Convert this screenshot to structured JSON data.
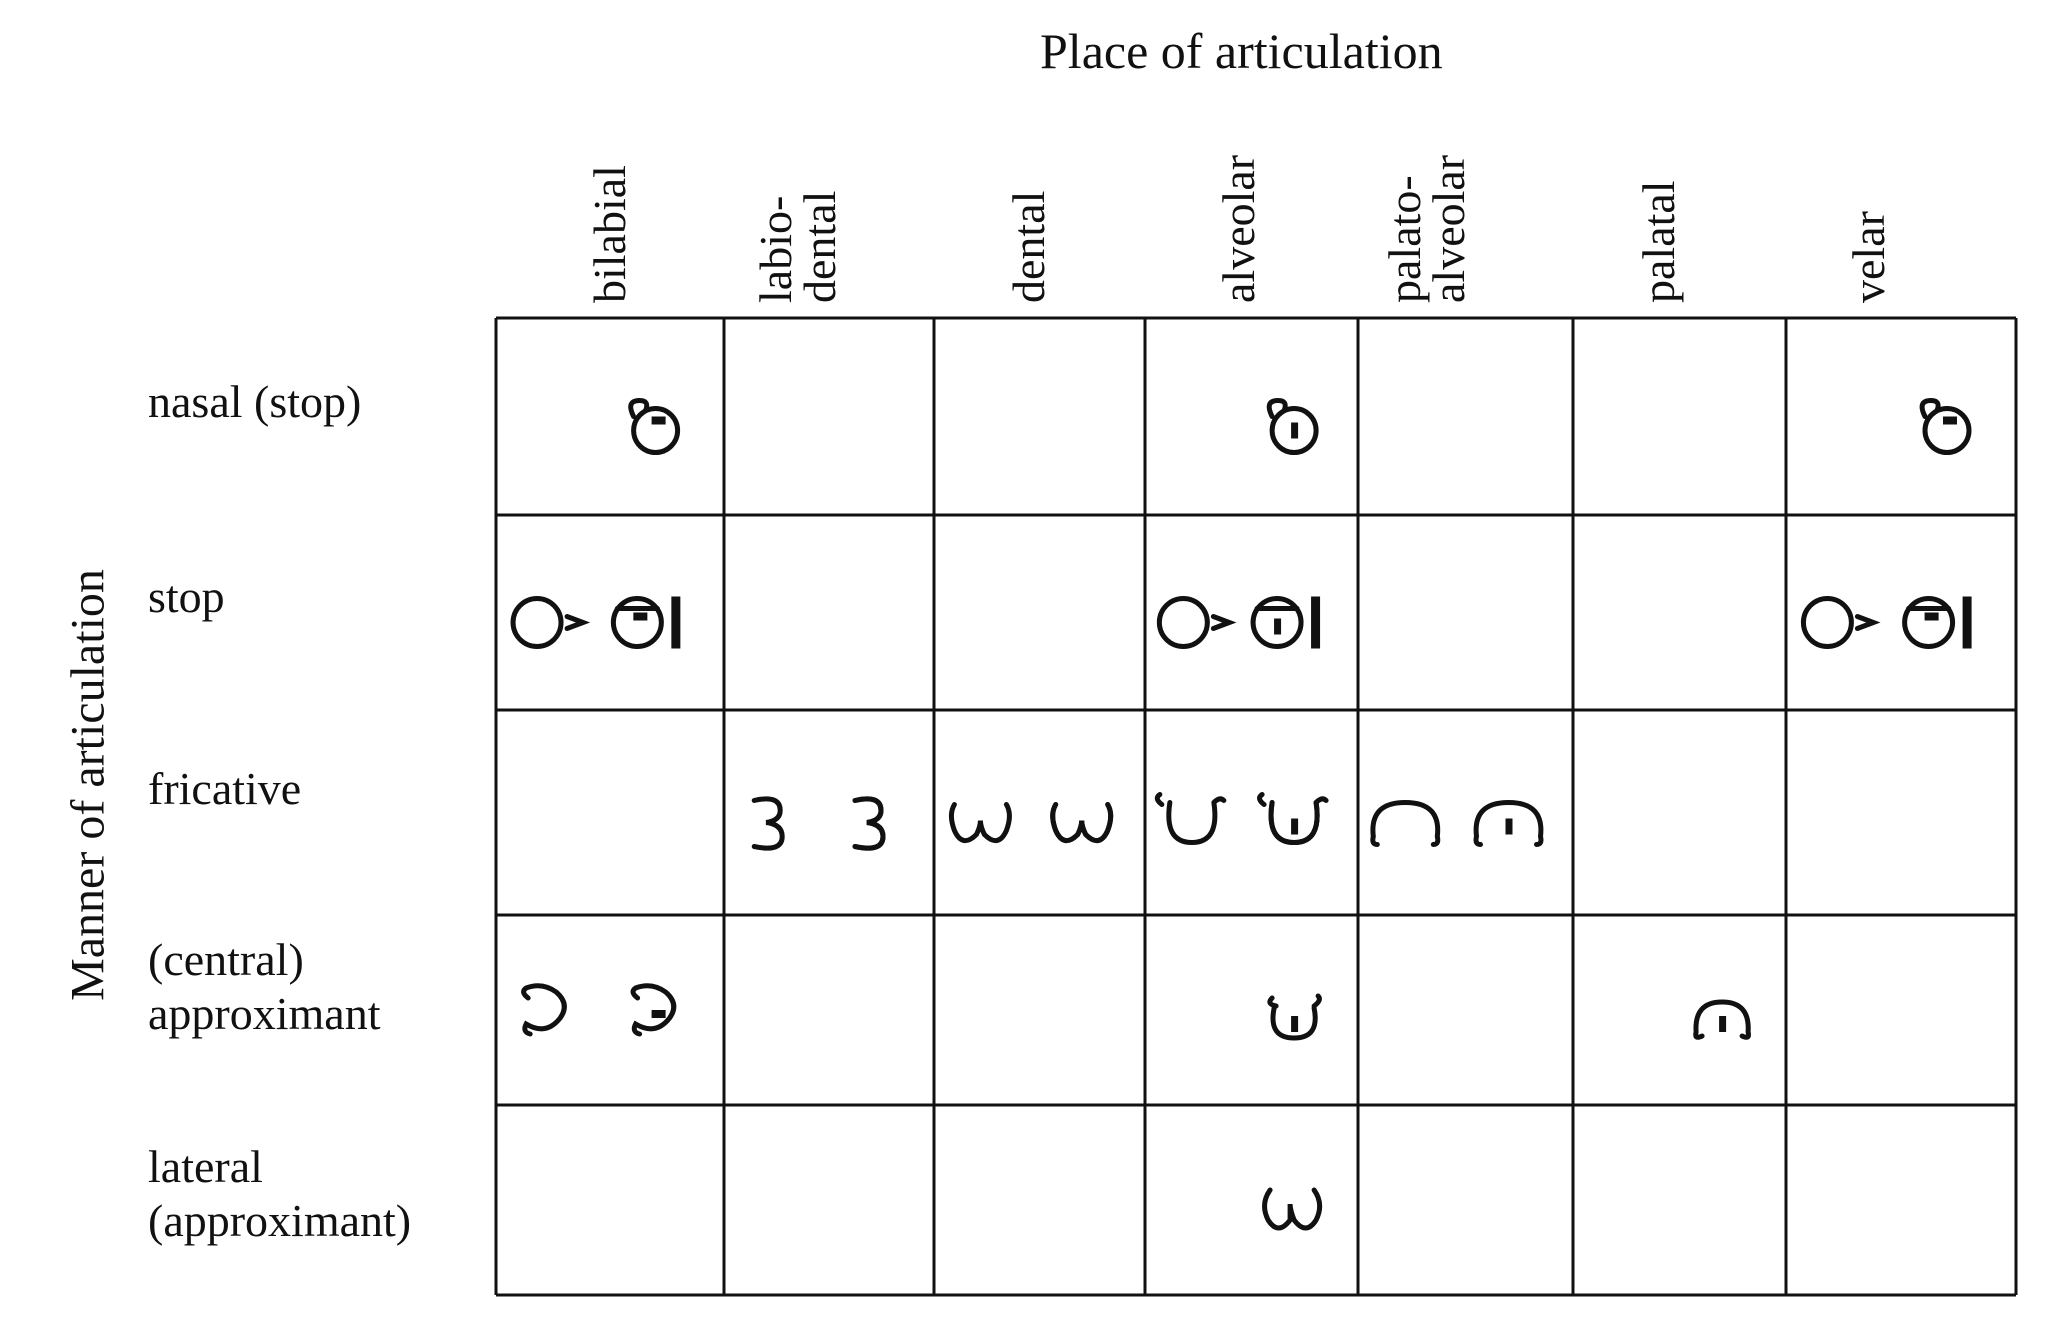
{
  "title": "Place of articulation",
  "yaxis_label": "Manner of articulation",
  "columns": [
    {
      "lines": [
        "bilabial"
      ]
    },
    {
      "lines": [
        "labio-",
        "dental"
      ]
    },
    {
      "lines": [
        "dental"
      ]
    },
    {
      "lines": [
        "alveolar"
      ]
    },
    {
      "lines": [
        "palato-",
        "alveolar"
      ]
    },
    {
      "lines": [
        "palatal"
      ]
    },
    {
      "lines": [
        "velar"
      ]
    }
  ],
  "rows": [
    {
      "lines": [
        "nasal (stop)"
      ]
    },
    {
      "lines": [
        "stop"
      ]
    },
    {
      "lines": [
        "fricative"
      ]
    },
    {
      "lines": [
        "(central)",
        "approximant"
      ]
    },
    {
      "lines": [
        "lateral",
        "(approximant)"
      ]
    }
  ],
  "cells": [
    {
      "row": 0,
      "col": 0,
      "symbols": [
        "nasal-bilabial-voiced"
      ]
    },
    {
      "row": 0,
      "col": 3,
      "symbols": [
        "nasal-alveolar-voiced"
      ]
    },
    {
      "row": 0,
      "col": 6,
      "symbols": [
        "nasal-velar-voiced"
      ]
    },
    {
      "row": 1,
      "col": 0,
      "symbols": [
        "stop-bilabial-voiceless",
        "stop-bilabial-voiced"
      ]
    },
    {
      "row": 1,
      "col": 3,
      "symbols": [
        "stop-alveolar-voiceless",
        "stop-alveolar-voiced"
      ]
    },
    {
      "row": 1,
      "col": 6,
      "symbols": [
        "stop-velar-voiceless",
        "stop-velar-voiced"
      ]
    },
    {
      "row": 2,
      "col": 1,
      "symbols": [
        "fricative-labiodental-voiceless",
        "fricative-labiodental-voiced"
      ]
    },
    {
      "row": 2,
      "col": 2,
      "symbols": [
        "fricative-dental-voiceless",
        "fricative-dental-voiced"
      ]
    },
    {
      "row": 2,
      "col": 3,
      "symbols": [
        "fricative-alveolar-voiceless",
        "fricative-alveolar-voiced"
      ]
    },
    {
      "row": 2,
      "col": 4,
      "symbols": [
        "fricative-palatoalveolar-voiceless",
        "fricative-palatoalveolar-voiced"
      ]
    },
    {
      "row": 3,
      "col": 0,
      "symbols": [
        "approximant-bilabial-voiceless",
        "approximant-bilabial-voiced"
      ]
    },
    {
      "row": 3,
      "col": 3,
      "symbols": [
        "approximant-alveolar-voiced"
      ]
    },
    {
      "row": 3,
      "col": 5,
      "symbols": [
        "approximant-palatal-voiced"
      ]
    },
    {
      "row": 4,
      "col": 3,
      "symbols": [
        "lateral-alveolar-voiced"
      ]
    }
  ]
}
